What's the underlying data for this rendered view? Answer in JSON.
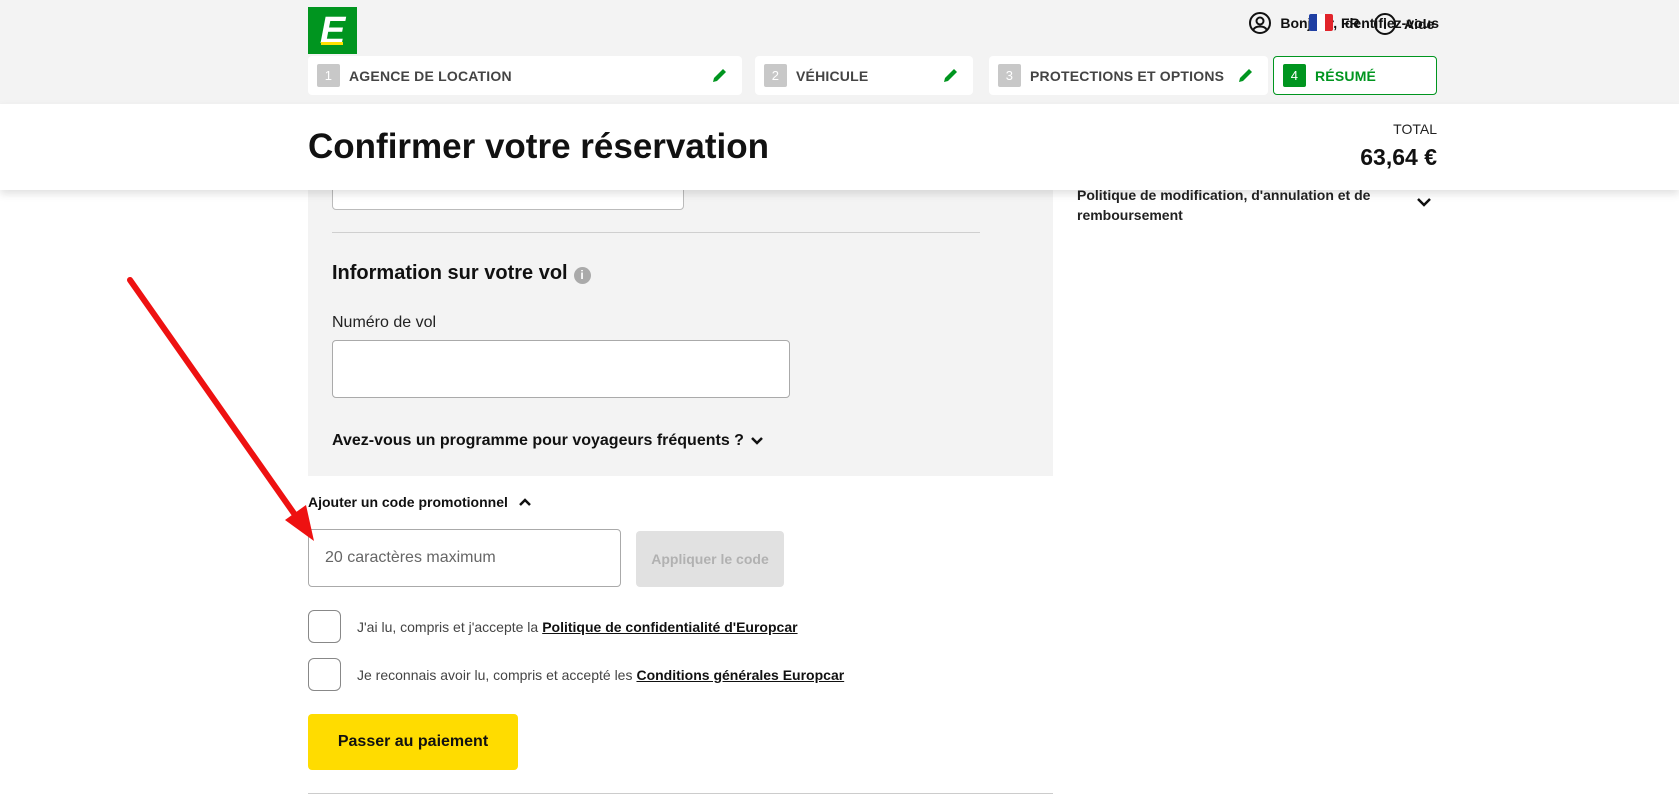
{
  "brand": {
    "logo_letter": "E",
    "green": "#00951f",
    "yellow": "#ffdc00"
  },
  "header": {
    "account_label": "Bonjour, Identifiez-vous",
    "lang_label": "FR",
    "help_label": "Aide"
  },
  "steps": [
    {
      "num": "1",
      "label": "AGENCE DE LOCATION",
      "state": "done"
    },
    {
      "num": "2",
      "label": "VÉHICULE",
      "state": "done"
    },
    {
      "num": "3",
      "label": "PROTECTIONS ET OPTIONS",
      "state": "done"
    },
    {
      "num": "4",
      "label": "RÉSUMÉ",
      "state": "active"
    }
  ],
  "title": "Confirmer votre réservation",
  "total": {
    "label": "TOTAL",
    "value": "63,64 €"
  },
  "flight": {
    "title": "Information sur votre vol",
    "info_icon": "i",
    "number_label": "Numéro de vol",
    "number_value": "",
    "ffp_label": "Avez-vous un programme pour voyageurs fréquents ?"
  },
  "promo": {
    "toggle_label": "Ajouter un code promotionnel",
    "placeholder": "20 caractères maximum",
    "apply_label": "Appliquer le code"
  },
  "consents": [
    {
      "text": "J'ai lu, compris et j'accepte la",
      "link": "Politique de confidentialité d'Europcar"
    },
    {
      "text": "Je reconnais avoir lu, compris et accepté les",
      "link": "Conditions générales Europcar"
    }
  ],
  "pay_label": "Passer au paiement",
  "policy_label": "Politique de modification, d'annulation et de remboursement",
  "annotation": {
    "color": "#ee1111",
    "icon": "red-arrow"
  }
}
